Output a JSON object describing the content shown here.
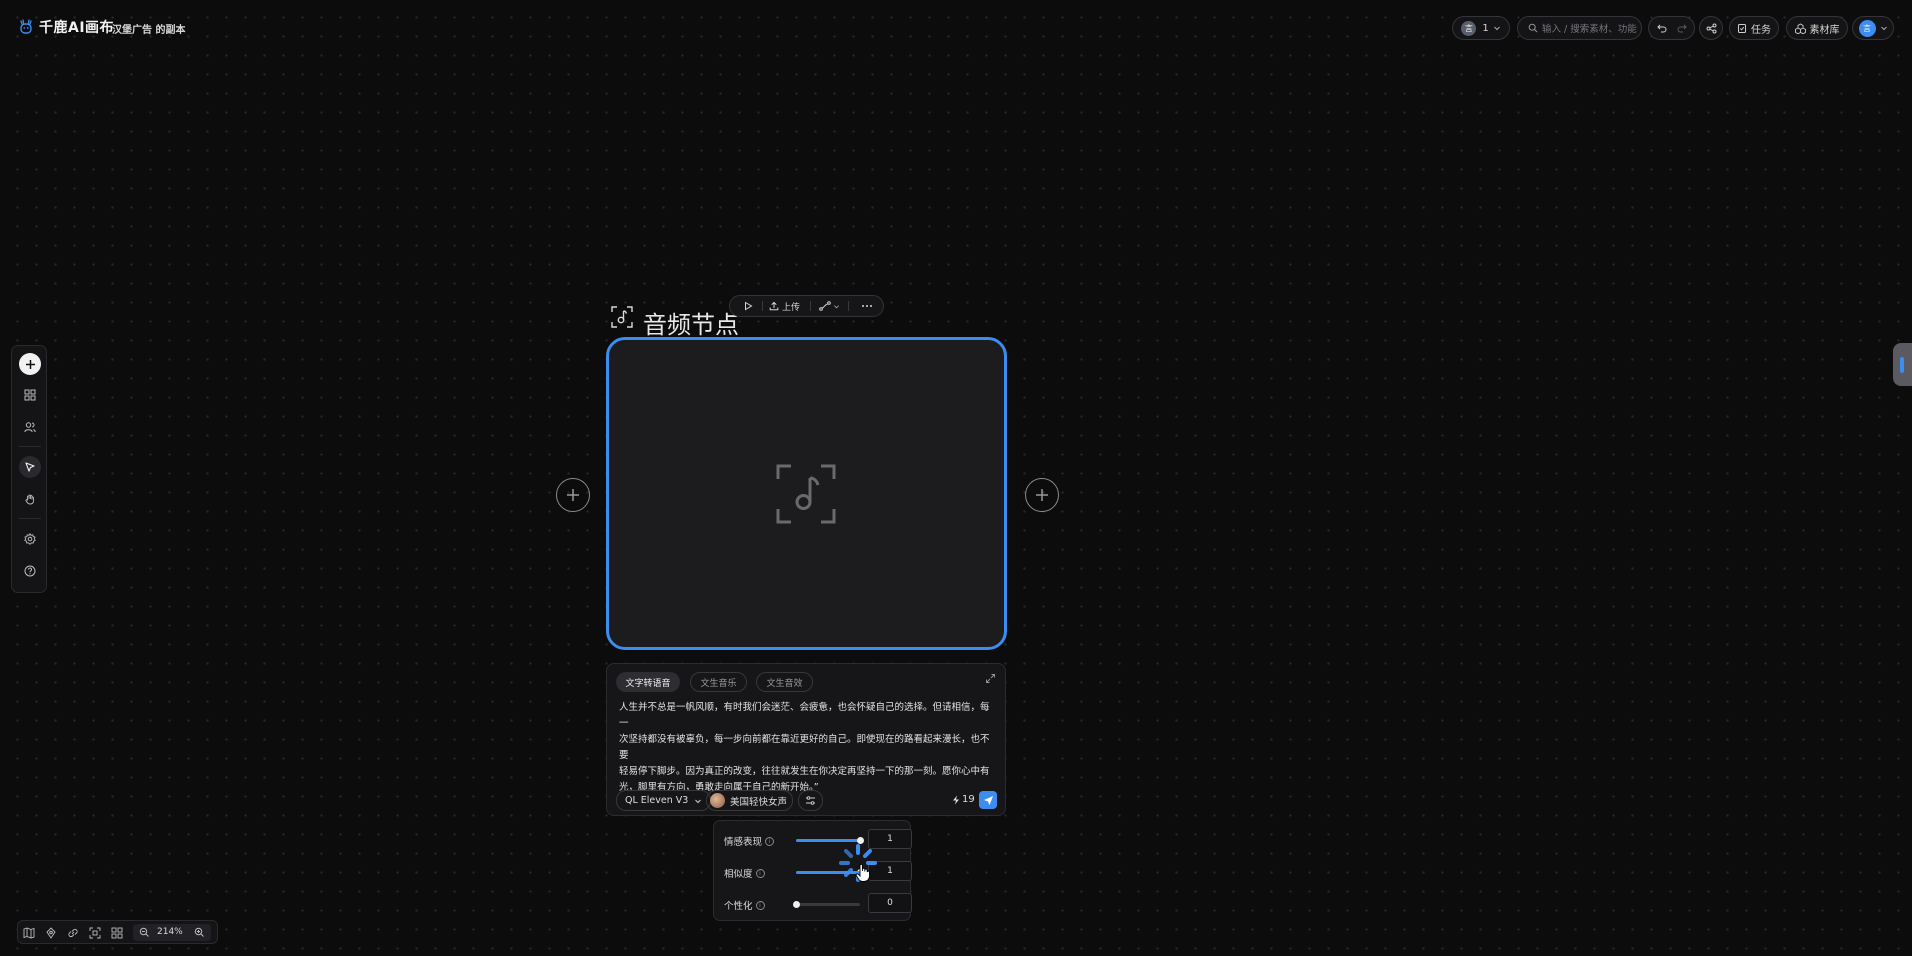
{
  "app": {
    "logo_text": "千鹿AI画布",
    "project_title": "汉堡广告 的副本"
  },
  "header": {
    "member_count": "1",
    "member_avatar_letter": "言",
    "search_placeholder": "输入 / 搜索素材、功能",
    "tasks_label": "任务",
    "assets_label": "素材库",
    "user_avatar_letter": "言"
  },
  "node": {
    "title": "音频节点",
    "toolbar": {
      "upload_label": "上传"
    }
  },
  "panel": {
    "tabs": [
      {
        "label": "文字转语音",
        "active": true
      },
      {
        "label": "文生音乐",
        "active": false
      },
      {
        "label": "文生音效",
        "active": false
      }
    ],
    "text_lines": [
      "人生并不总是一帆风顺，有时我们会迷茫、会疲惫，也会怀疑自己的选择。但请相信，每一",
      "次坚持都没有被辜负，每一步向前都在靠近更好的自己。即使现在的路看起来漫长，也不要",
      "轻易停下脚步。因为真正的改变，往往就发生在你决定再坚持一下的那一刻。愿你心中有",
      "光，脚里有方向，勇敢走向属于自己的新开始。”"
    ],
    "model_label": "QL Eleven V3",
    "voice_label": "美国轻快女声",
    "credits": "19"
  },
  "popover": {
    "sliders": [
      {
        "label": "情感表现",
        "value": "1",
        "fraction": 1.0
      },
      {
        "label": "相似度",
        "value": "1",
        "fraction": 1.0
      },
      {
        "label": "个性化",
        "value": "0",
        "fraction": 0.0
      }
    ]
  },
  "zoom": {
    "level": "214%"
  },
  "colors": {
    "accent": "#3d8cf0",
    "background": "#0c0c0d",
    "panel": "#161618"
  }
}
